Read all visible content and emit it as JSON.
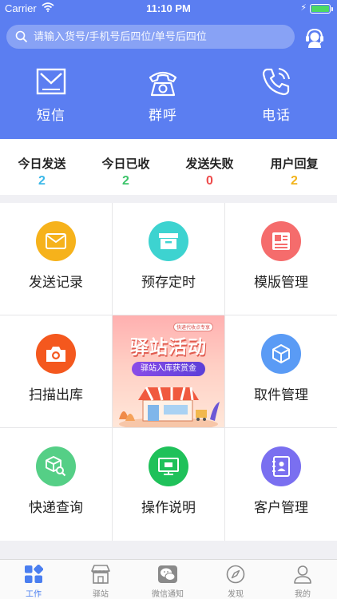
{
  "status_bar": {
    "carrier": "Carrier",
    "time": "11:10 PM"
  },
  "search": {
    "placeholder": "请输入货号/手机号后四位/单号后四位"
  },
  "quick_actions": [
    {
      "label": "短信",
      "icon": "sms-icon"
    },
    {
      "label": "群呼",
      "icon": "group-call-icon"
    },
    {
      "label": "电话",
      "icon": "phone-icon"
    }
  ],
  "stats": [
    {
      "title": "今日发送",
      "value": "2",
      "color": "#3bb8e8"
    },
    {
      "title": "今日已收",
      "value": "2",
      "color": "#3cc46a"
    },
    {
      "title": "发送失败",
      "value": "0",
      "color": "#ee4b4b"
    },
    {
      "title": "用户回复",
      "value": "2",
      "color": "#f2b31b"
    }
  ],
  "grid": [
    {
      "label": "发送记录",
      "icon": "mail-icon",
      "color": "#f6b21b"
    },
    {
      "label": "预存定时",
      "icon": "archive-box-icon",
      "color": "#3dd3d0"
    },
    {
      "label": "模版管理",
      "icon": "template-icon",
      "color": "#f56c6c"
    },
    {
      "label": "扫描出库",
      "icon": "camera-icon",
      "color": "#f4581e"
    },
    {
      "label": "取件管理",
      "icon": "package-cube-icon",
      "color": "#5a9bf5"
    },
    {
      "label": "快递查询",
      "icon": "parcel-search-icon",
      "color": "#55cf86"
    },
    {
      "label": "操作说明",
      "icon": "instructions-icon",
      "color": "#1fc15a"
    },
    {
      "label": "客户管理",
      "icon": "contacts-icon",
      "color": "#7a6ff0"
    }
  ],
  "banner": {
    "tag": "快递代收点专享",
    "title": "驿站活动",
    "subtitle": "驿站入库获赏金"
  },
  "tabbar": [
    {
      "label": "工作",
      "icon": "work-grid-icon",
      "active": true
    },
    {
      "label": "驿站",
      "icon": "station-store-icon",
      "active": false
    },
    {
      "label": "微信通知",
      "icon": "wechat-icon",
      "active": false
    },
    {
      "label": "发现",
      "icon": "compass-icon",
      "active": false
    },
    {
      "label": "我的",
      "icon": "profile-icon",
      "active": false
    }
  ],
  "colors": {
    "header": "#5b7ef1",
    "tab_active": "#4a7ef0",
    "tab_inactive": "#8a8a8a"
  }
}
